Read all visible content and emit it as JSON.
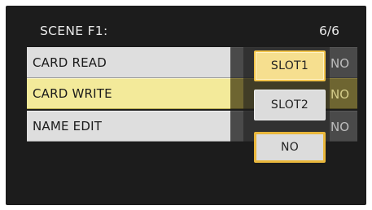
{
  "header": {
    "title": "SCENE F1:",
    "page": "6/6"
  },
  "menu": {
    "rows": [
      {
        "label": "CARD READ",
        "value": "NO"
      },
      {
        "label": "CARD WRITE",
        "value": "NO"
      },
      {
        "label": "NAME EDIT",
        "value": "NO"
      }
    ]
  },
  "popup": {
    "options": [
      "SLOT1",
      "SLOT2",
      "NO"
    ]
  },
  "colors": {
    "selection": "#f3ea9a",
    "highlight_border": "#e9b73c",
    "background": "#1c1c1c"
  }
}
